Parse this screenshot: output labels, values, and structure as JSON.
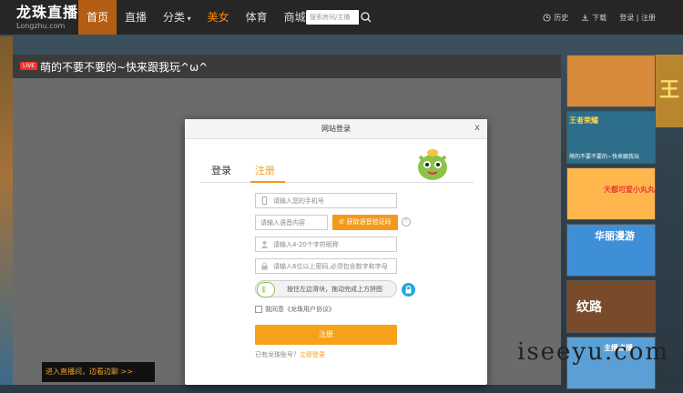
{
  "site": {
    "logo_cn": "龙珠直播",
    "logo_en": "Longzhu.com"
  },
  "nav": {
    "items": [
      {
        "label": "首页",
        "active": true
      },
      {
        "label": "直播"
      },
      {
        "label": "分类"
      },
      {
        "label": "美女",
        "hot": true
      },
      {
        "label": "体育"
      },
      {
        "label": "商城"
      }
    ]
  },
  "search": {
    "placeholder": "搜索房间/主播"
  },
  "header_right": {
    "history": "历史",
    "download": "下载",
    "login_register": "登录 | 注册"
  },
  "video": {
    "live_badge": "LIVE",
    "title": "萌的不要不要的~快来跟我玩^ω^"
  },
  "ticker": {
    "text": "进入直播间，边看边聊 >>"
  },
  "thumbs": [
    {
      "caption": "",
      "color": "#d68a3a"
    },
    {
      "caption": "王者荣耀",
      "color": "#2d6e8a"
    },
    {
      "caption": "萌的不要不要的~快来跟我玩",
      "color": "#3a3a3a"
    },
    {
      "caption": "天都可爱小丸丸",
      "color": "#ffb74d"
    },
    {
      "caption": "华丽漫游",
      "color": "#3f8fd6"
    },
    {
      "caption": "纹路",
      "color": "#7a4b2a"
    },
    {
      "caption": "主播点播",
      "color": "#5aa0d6"
    }
  ],
  "modal": {
    "title": "网站登录",
    "close": "x",
    "tabs": {
      "login": "登录",
      "register": "注册"
    },
    "phone_placeholder": "请输入您的手机号",
    "code_placeholder": "请输入语音内容",
    "sms_button": "获取语音验证码",
    "help": "?",
    "nickname_placeholder": "请输入4-20个字符昵称",
    "password_placeholder": "请输入6位以上密码,必须包含数字和字母",
    "slider_text": "按住左边滑块，拖动完成上方拼图",
    "agree_text": "我同意《龙珠用户协议》",
    "register_button": "注册",
    "have_account": "已有龙珠账号？",
    "login_link": "立即登录"
  },
  "watermark": "iseeyu.com",
  "colors": {
    "accent": "#f39a1c",
    "nav_active": "#b35e14",
    "lock_blue": "#22a7e0"
  }
}
